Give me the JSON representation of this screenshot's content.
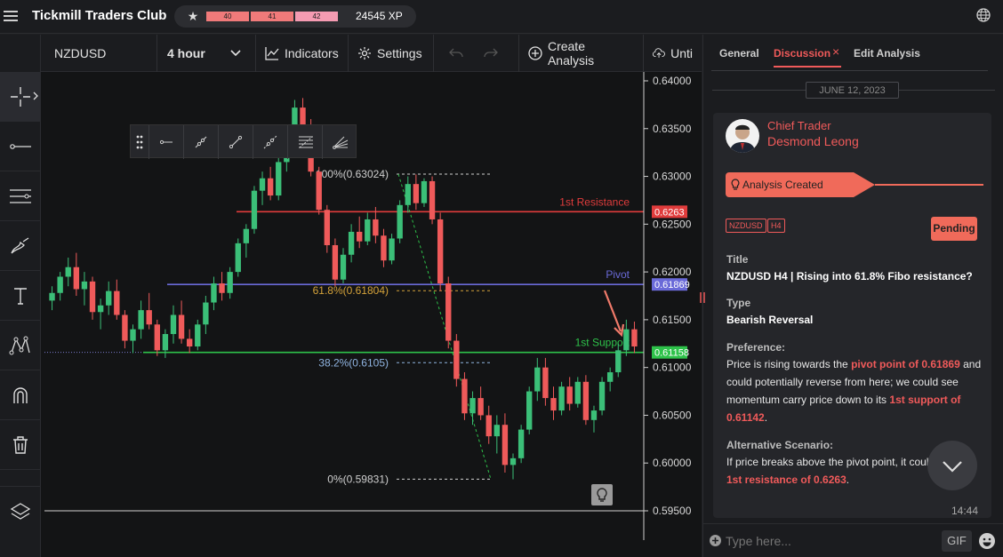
{
  "app": {
    "title": "Tickmill Traders Club",
    "levels": [
      "40",
      "41",
      "42"
    ],
    "xp": "24545 XP"
  },
  "toolbar": {
    "symbol": "NZDUSD",
    "timeframe": "4 hour",
    "indicators": "Indicators",
    "settings": "Settings",
    "create_analysis": "Create Analysis",
    "until": "Unti"
  },
  "chart_data": {
    "type": "candlestick",
    "symbol": "NZDUSD",
    "timeframe": "4 hour",
    "y_ticks": [
      "0.64000",
      "0.63500",
      "0.63000",
      "0.62500",
      "0.62000",
      "0.61500",
      "0.61000",
      "0.60500",
      "0.60000",
      "0.59500"
    ],
    "ylim": [
      0.595,
      0.64
    ],
    "levels": [
      {
        "label": "1st Resistance",
        "value": 0.6263,
        "tag": "0.6263",
        "color": "#e03c3c"
      },
      {
        "label": "Pivot",
        "value": 0.61869,
        "tag": "0.61869",
        "color": "#6a6ad8"
      },
      {
        "label": "1st Support",
        "value": 0.61158,
        "tag": "0.61158",
        "color": "#2ec24a"
      }
    ],
    "fibonacci": [
      {
        "label": "100%(0.63024)",
        "value": 0.63024,
        "color": "#cfcfcf"
      },
      {
        "label": "61.8%(0.61804)",
        "value": 0.61804,
        "color": "#d4a23a"
      },
      {
        "label": "38.2%(0.6105)",
        "value": 0.6105,
        "color": "#8fb3e0"
      },
      {
        "label": "0%(0.59831)",
        "value": 0.59831,
        "color": "#cfcfcf"
      }
    ],
    "candles": [
      [
        0.617,
        0.6185,
        0.616,
        0.6178
      ],
      [
        0.6178,
        0.62,
        0.617,
        0.6195
      ],
      [
        0.6195,
        0.6215,
        0.6185,
        0.6205
      ],
      [
        0.6205,
        0.622,
        0.6175,
        0.6182
      ],
      [
        0.6182,
        0.62,
        0.6165,
        0.619
      ],
      [
        0.619,
        0.6195,
        0.615,
        0.6158
      ],
      [
        0.6158,
        0.6172,
        0.614,
        0.6165
      ],
      [
        0.6165,
        0.619,
        0.6155,
        0.618
      ],
      [
        0.618,
        0.6192,
        0.615,
        0.6155
      ],
      [
        0.6155,
        0.616,
        0.612,
        0.6128
      ],
      [
        0.6128,
        0.6145,
        0.6115,
        0.614
      ],
      [
        0.614,
        0.617,
        0.613,
        0.616
      ],
      [
        0.616,
        0.6178,
        0.614,
        0.6145
      ],
      [
        0.6145,
        0.615,
        0.6112,
        0.6118
      ],
      [
        0.6118,
        0.614,
        0.611,
        0.6135
      ],
      [
        0.6135,
        0.6165,
        0.6125,
        0.6155
      ],
      [
        0.6155,
        0.617,
        0.6125,
        0.613
      ],
      [
        0.613,
        0.614,
        0.6115,
        0.6122
      ],
      [
        0.6122,
        0.615,
        0.6118,
        0.6145
      ],
      [
        0.6145,
        0.6175,
        0.6135,
        0.6168
      ],
      [
        0.6168,
        0.6195,
        0.616,
        0.6188
      ],
      [
        0.6188,
        0.62,
        0.617,
        0.6178
      ],
      [
        0.6178,
        0.6205,
        0.6172,
        0.62
      ],
      [
        0.62,
        0.6235,
        0.6195,
        0.623
      ],
      [
        0.623,
        0.625,
        0.6215,
        0.6245
      ],
      [
        0.6245,
        0.629,
        0.624,
        0.6285
      ],
      [
        0.6285,
        0.6305,
        0.627,
        0.6298
      ],
      [
        0.6298,
        0.631,
        0.6275,
        0.628
      ],
      [
        0.628,
        0.632,
        0.6275,
        0.6315
      ],
      [
        0.6315,
        0.635,
        0.6305,
        0.6345
      ],
      [
        0.6345,
        0.638,
        0.6335,
        0.6372
      ],
      [
        0.6372,
        0.6382,
        0.6345,
        0.6352
      ],
      [
        0.6352,
        0.636,
        0.63,
        0.6305
      ],
      [
        0.6305,
        0.631,
        0.626,
        0.6265
      ],
      [
        0.6265,
        0.627,
        0.622,
        0.6228
      ],
      [
        0.6228,
        0.6235,
        0.6185,
        0.6192
      ],
      [
        0.6192,
        0.6225,
        0.6188,
        0.6218
      ],
      [
        0.6218,
        0.625,
        0.621,
        0.6242
      ],
      [
        0.6242,
        0.6258,
        0.6225,
        0.6232
      ],
      [
        0.6232,
        0.6262,
        0.6228,
        0.6255
      ],
      [
        0.6255,
        0.6268,
        0.623,
        0.6238
      ],
      [
        0.6238,
        0.6245,
        0.6205,
        0.6212
      ],
      [
        0.6212,
        0.624,
        0.6208,
        0.6235
      ],
      [
        0.6235,
        0.6275,
        0.623,
        0.627
      ],
      [
        0.627,
        0.63,
        0.6262,
        0.6292
      ],
      [
        0.6292,
        0.6302,
        0.6265,
        0.6272
      ],
      [
        0.6272,
        0.6298,
        0.6268,
        0.6295
      ],
      [
        0.6295,
        0.63,
        0.625,
        0.6255
      ],
      [
        0.6255,
        0.6262,
        0.618,
        0.6188
      ],
      [
        0.6188,
        0.6195,
        0.612,
        0.6128
      ],
      [
        0.6128,
        0.6135,
        0.608,
        0.6088
      ],
      [
        0.6088,
        0.6095,
        0.6045,
        0.6052
      ],
      [
        0.6052,
        0.6075,
        0.604,
        0.6068
      ],
      [
        0.6068,
        0.608,
        0.6045,
        0.605
      ],
      [
        0.605,
        0.606,
        0.602,
        0.6028
      ],
      [
        0.6028,
        0.605,
        0.601,
        0.604
      ],
      [
        0.604,
        0.6052,
        0.599,
        0.5998
      ],
      [
        0.5998,
        0.601,
        0.5983,
        0.6005
      ],
      [
        0.6005,
        0.604,
        0.6,
        0.6035
      ],
      [
        0.6035,
        0.608,
        0.603,
        0.6075
      ],
      [
        0.6075,
        0.611,
        0.6065,
        0.61
      ],
      [
        0.61,
        0.611,
        0.606,
        0.6068
      ],
      [
        0.6068,
        0.608,
        0.6045,
        0.6055
      ],
      [
        0.6055,
        0.6085,
        0.605,
        0.608
      ],
      [
        0.608,
        0.609,
        0.6055,
        0.6062
      ],
      [
        0.6062,
        0.609,
        0.6058,
        0.6085
      ],
      [
        0.6085,
        0.6092,
        0.604,
        0.6045
      ],
      [
        0.6045,
        0.606,
        0.6032,
        0.6055
      ],
      [
        0.6055,
        0.609,
        0.605,
        0.6085
      ],
      [
        0.6085,
        0.61,
        0.6075,
        0.6095
      ],
      [
        0.6095,
        0.6125,
        0.609,
        0.6118
      ],
      [
        0.6118,
        0.615,
        0.6112,
        0.614
      ],
      [
        0.614,
        0.6148,
        0.6115,
        0.6122
      ]
    ]
  },
  "panel": {
    "tabs": [
      "General",
      "Discussion",
      "Edit Analysis"
    ],
    "date": "JUNE 12, 2023",
    "author_role": "Chief Trader",
    "author_name": "Desmond Leong",
    "event": "Analysis Created",
    "tags": [
      "NZDUSD",
      "H4"
    ],
    "status": "Pending",
    "title_label": "Title",
    "title": "NZDUSD H4 | Rising into 61.8% Fibo resistance?",
    "type_label": "Type",
    "type": "Bearish Reversal",
    "pref_label": "Preference:",
    "pref_1": "Price is rising towards the ",
    "pref_hl_1": "pivot point of 0.61869",
    "pref_2": " and could potentially reverse from here; we could see momentum carry price down to its ",
    "pref_hl_2": "1st support of 0.61142",
    "pref_3": ".",
    "alt_label": "Alternative Scenario:",
    "alt_1": "If price breaks above the pivot point, it coul",
    "alt_hl": "1st resistance of 0.6263",
    "alt_2": ".",
    "time": "14:44",
    "input_placeholder": "Type here...",
    "gif": "GIF"
  }
}
